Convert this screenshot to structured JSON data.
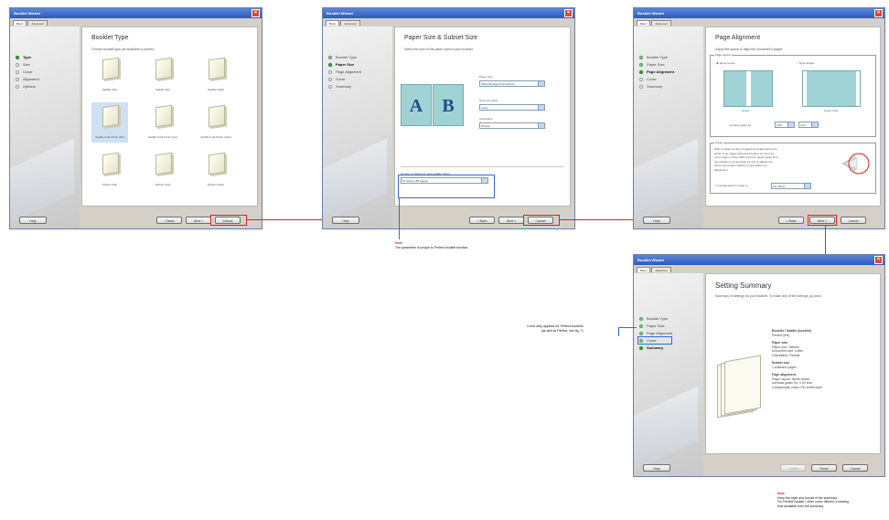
{
  "windows": {
    "w1": {
      "title": "Booklet Wizard",
      "tabs": [
        "Basic",
        "Advanced"
      ],
      "heading": "Booklet Type",
      "subtitle": "Choose booklet type (as available to printer)",
      "steps": [
        "Type",
        "Size",
        "Cover",
        "Alignment",
        "Options"
      ],
      "current_step": 0,
      "help": "Help",
      "back": "< Back",
      "next": "Next >",
      "cancel": "Cancel",
      "thumbs": [
        "Saddle (left)",
        "Saddle (top)",
        "Saddle (right)",
        "Saddle Fold Finish (left)",
        "Saddle Fold Finish (top)",
        "Saddle Fold Finish (right)",
        "Perfect (left)",
        "Perfect (top)",
        "Perfect (right)"
      ]
    },
    "w2": {
      "title": "Booklet Wizard",
      "tabs": [
        "Basic",
        "Advanced"
      ],
      "heading": "Paper Size & Subset Size",
      "subtitle": "Select the size of the paper used in your booklet",
      "steps": [
        "Booklet Type",
        "Paper Size",
        "Page Alignment",
        "Cover",
        "Summary"
      ],
      "current_step": 1,
      "help": "Help",
      "back": "< Back",
      "next": "Next >",
      "cancel": "Cancel",
      "letter_a": "A",
      "letter_b": "B",
      "paper_size_label": "Paper Size",
      "paper_size_value": "Tabloid/Ledger/Inches/Kerp",
      "document_size_label": "Document Size",
      "document_size_value": "Letter",
      "orientation_label": "Orientation",
      "orientation_value": "Portrait",
      "sheets_label": "Number of Sheets in each saddle subset",
      "sheets_value": "15 sheets (60 pages)"
    },
    "w3": {
      "title": "Booklet Wizard",
      "tabs": [
        "Basic",
        "Advanced"
      ],
      "heading": "Page Alignment",
      "subtitle": "Adjust the space to align the document's pages",
      "steps": [
        "Booklet Type",
        "Paper Size",
        "Page Alignment",
        "Cover",
        "Summary"
      ],
      "current_step": 2,
      "help": "Help",
      "back": "< Back",
      "next": "Next >",
      "cancel": "Cancel",
      "group_label": "Page Layout",
      "opt1": "Spine Center",
      "opt2": "Spine Edges",
      "cap1": "Gutter",
      "cap2": "Gutter Side",
      "gutter_label": "Increase gutter by",
      "gutter_value": "0.00",
      "gutter_unit": "Inch",
      "creep_label": "Creep",
      "creep_text": [
        "When a large number of pages are folded along the",
        "spine, inner pages will extend further out than the",
        "outer pages. Creep shifts the inner pages away from",
        "the outside to compensate for this. It adjusts the",
        "space and makes shifting compensation for",
        "adjustment."
      ],
      "creep_check": "Compensate for creep to",
      "creep_value": "Per Sheet"
    },
    "w4": {
      "title": "Booklet Wizard",
      "tabs": [
        "Basic",
        "Advanced"
      ],
      "heading": "Setting Summary",
      "subtitle": "Summary of settings for your booklet. To make any of the settings, go back.",
      "steps": [
        "Booklet Type",
        "Paper Size",
        "Page Alignment",
        "Cover",
        "Summary"
      ],
      "current_step": 4,
      "help": "Help",
      "back": "< Back",
      "finish": "Finish",
      "cancel": "Cancel",
      "summary": [
        {
          "h": "Booklet / Saddle (booklet)",
          "l": [
            "Perfect (left)"
          ]
        },
        {
          "h": "Paper size",
          "l": [
            "Paper size: Tabloid",
            "Document size: Letter",
            "Orientation: Portrait"
          ]
        },
        {
          "h": "Subset size",
          "l": [
            "1 sheets/4 pages"
          ]
        },
        {
          "h": "Page alignment",
          "l": [
            "Page Layout: Spine center",
            "Increase gutter by: 0.00 inch",
            "Compensate creep: Per sheet layer"
          ]
        }
      ]
    }
  },
  "notes": {
    "n1": {
      "head": "Note",
      "text": "The parameter is unique to Perfect booklet function."
    },
    "n2": {
      "text": [
        "Cover step appears for Perfect booklets",
        "(as well as Perfect, see fig. 7)"
      ]
    },
    "n3": {
      "head": "Note",
      "text": [
        "Keep the style and format of the summary.",
        "For Perfect Saddle / other cover offered, a reading",
        "flow available from the summary."
      ]
    }
  }
}
